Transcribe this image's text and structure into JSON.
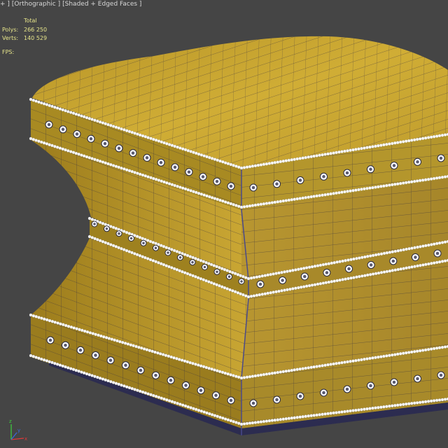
{
  "viewport": {
    "label_parts": [
      "+ ]",
      "[Orthographic ]",
      "[Shaded + Edged Faces ]"
    ],
    "colors": {
      "background": "#454545",
      "stats_text": "#e6e48a",
      "gold": "#c7a62c",
      "gold_dark": "#8a6d14",
      "wire": "#2a2a45",
      "studs": "#ffffff"
    }
  },
  "stats": {
    "header": "Total",
    "polys_label": "Polys:",
    "polys_value": "266 250",
    "verts_label": "Verts:",
    "verts_value": "140 529",
    "fps_label": "FPS:"
  },
  "scene": {
    "object": "ottoman-3d-model",
    "axis_gizmo": {
      "x_label": "x",
      "y_label": "y",
      "z_label": "z"
    }
  }
}
